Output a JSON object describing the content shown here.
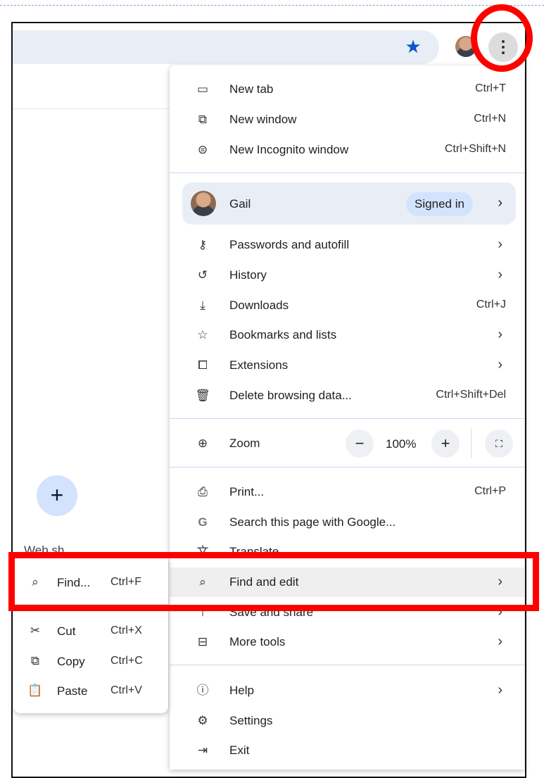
{
  "toolbar": {
    "bookmark_icon": "star-icon",
    "profile_icon": "avatar",
    "menu_icon": "kebab-menu-icon"
  },
  "page": {
    "fab_symbol": "+",
    "partial_text": "Web sh..."
  },
  "menu": {
    "items_top": [
      {
        "label": "New tab",
        "shortcut": "Ctrl+T",
        "icon": "new-tab-icon"
      },
      {
        "label": "New window",
        "shortcut": "Ctrl+N",
        "icon": "new-window-icon"
      },
      {
        "label": "New Incognito window",
        "shortcut": "Ctrl+Shift+N",
        "icon": "incognito-icon"
      }
    ],
    "profile": {
      "name": "Gail",
      "status": "Signed in"
    },
    "items_mid": [
      {
        "label": "Passwords and autofill",
        "shortcut": "",
        "icon": "key-icon"
      },
      {
        "label": "History",
        "shortcut": "",
        "icon": "history-icon"
      },
      {
        "label": "Downloads",
        "shortcut": "Ctrl+J",
        "icon": "download-icon"
      },
      {
        "label": "Bookmarks and lists",
        "shortcut": "",
        "icon": "star-outline-icon"
      },
      {
        "label": "Extensions",
        "shortcut": "",
        "icon": "puzzle-icon"
      },
      {
        "label": "Delete browsing data...",
        "shortcut": "Ctrl+Shift+Del",
        "icon": "trash-icon"
      }
    ],
    "zoom": {
      "label": "Zoom",
      "value": "100%",
      "minus": "−",
      "plus": "+"
    },
    "items_lower": [
      {
        "label": "Print...",
        "shortcut": "Ctrl+P",
        "icon": "print-icon"
      },
      {
        "label": "Search this page with Google...",
        "shortcut": "",
        "icon": "google-icon"
      },
      {
        "label": "Translate...",
        "shortcut": "",
        "icon": "translate-icon"
      },
      {
        "label": "Find and edit",
        "shortcut": "",
        "icon": "find-icon"
      },
      {
        "label": "Save and share",
        "shortcut": "",
        "icon": "save-icon"
      },
      {
        "label": "More tools",
        "shortcut": "",
        "icon": "toolbox-icon"
      }
    ],
    "items_bottom": [
      {
        "label": "Help",
        "shortcut": "",
        "icon": "help-icon"
      },
      {
        "label": "Settings",
        "shortcut": "",
        "icon": "gear-icon"
      },
      {
        "label": "Exit",
        "shortcut": "",
        "icon": "exit-icon"
      }
    ]
  },
  "submenu": {
    "items": [
      {
        "label": "Find...",
        "shortcut": "Ctrl+F",
        "icon": "find-icon"
      },
      {
        "label": "Cut",
        "shortcut": "Ctrl+X",
        "icon": "scissors-icon"
      },
      {
        "label": "Copy",
        "shortcut": "Ctrl+C",
        "icon": "copy-icon"
      },
      {
        "label": "Paste",
        "shortcut": "Ctrl+V",
        "icon": "paste-icon"
      }
    ]
  },
  "colors": {
    "accent": "#0b57d0",
    "annotation": "#ff0000",
    "profile_bg": "#e9eef6",
    "pill_bg": "#d3e3fd"
  }
}
